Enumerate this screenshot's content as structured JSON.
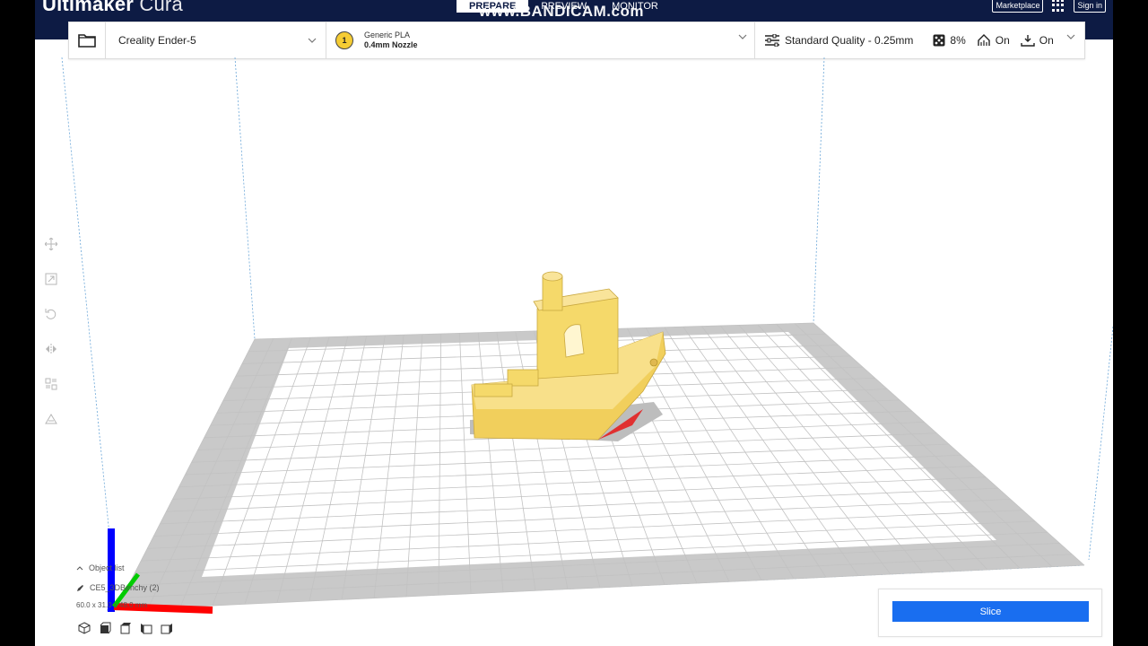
{
  "app": {
    "brand_bold": "Ultimaker",
    "brand_light": "Cura"
  },
  "stages": [
    {
      "label": "PREPARE",
      "active": true
    },
    {
      "label": "PREVIEW",
      "active": false
    },
    {
      "label": "MONITOR",
      "active": false
    }
  ],
  "watermark": "www.BANDICAM.com",
  "header_right": {
    "marketplace_label": "Marketplace",
    "signin_label": "Sign in"
  },
  "toolbar": {
    "printer": "Creality Ender-5",
    "extruder_number": "1",
    "material_name": "Generic PLA",
    "nozzle": "0.4mm Nozzle",
    "profile": "Standard Quality - 0.25mm",
    "infill": "8%",
    "support": "On",
    "adhesion": "On"
  },
  "object_list": {
    "header": "Object list",
    "item": "CE5_3DBenchy (2)",
    "dimensions": "60.0 x 31.0 x 48.0 mm"
  },
  "slice": {
    "label": "Slice"
  },
  "colors": {
    "header_bg": "#0d1b44",
    "slice_button": "#196ef0",
    "model": "#f5d96a",
    "axis_x": "#ff0000",
    "axis_y": "#00cc00",
    "axis_z": "#0000ff"
  }
}
